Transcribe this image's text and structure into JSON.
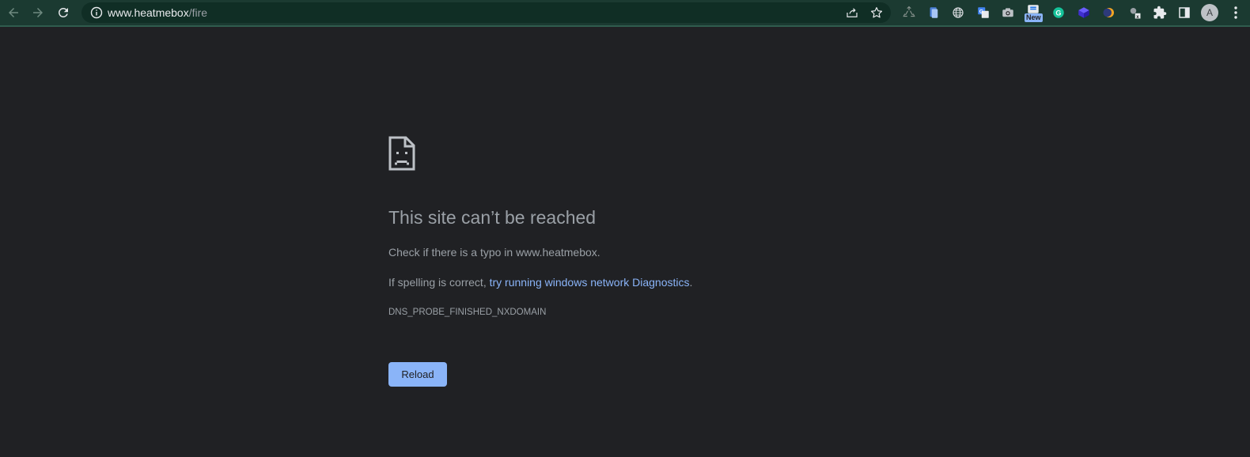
{
  "browser": {
    "url_host": "www.heatmebox",
    "url_path": "/fire",
    "extension_badge": "New",
    "profile_initial": "A"
  },
  "error_page": {
    "title": "This site can’t be reached",
    "line1": "Check if there is a typo in www.heatmebox.",
    "line2_prefix": "If spelling is correct, ",
    "line2_link": "try running windows network Diagnostics",
    "line2_suffix": ".",
    "error_code": "DNS_PROBE_FINISHED_NXDOMAIN",
    "reload_label": "Reload"
  },
  "colors": {
    "toolbar": "#1b3a31",
    "omnibox": "#102e25",
    "page_background": "#202124",
    "text": "#9aa0a6",
    "link": "#8ab4f8",
    "button": "#8ab4f8"
  },
  "icons": [
    "back-arrow-icon",
    "forward-arrow-icon",
    "reload-icon",
    "info-icon",
    "share-icon",
    "star-icon",
    "recycle-icon",
    "file-icon",
    "globe-icon",
    "translate-icon",
    "camera-icon",
    "new-ext-icon",
    "grammarly-icon",
    "cube-icon",
    "moon-icon",
    "gadget-icon",
    "puzzle-icon",
    "sidebar-icon",
    "sad-page-icon"
  ]
}
